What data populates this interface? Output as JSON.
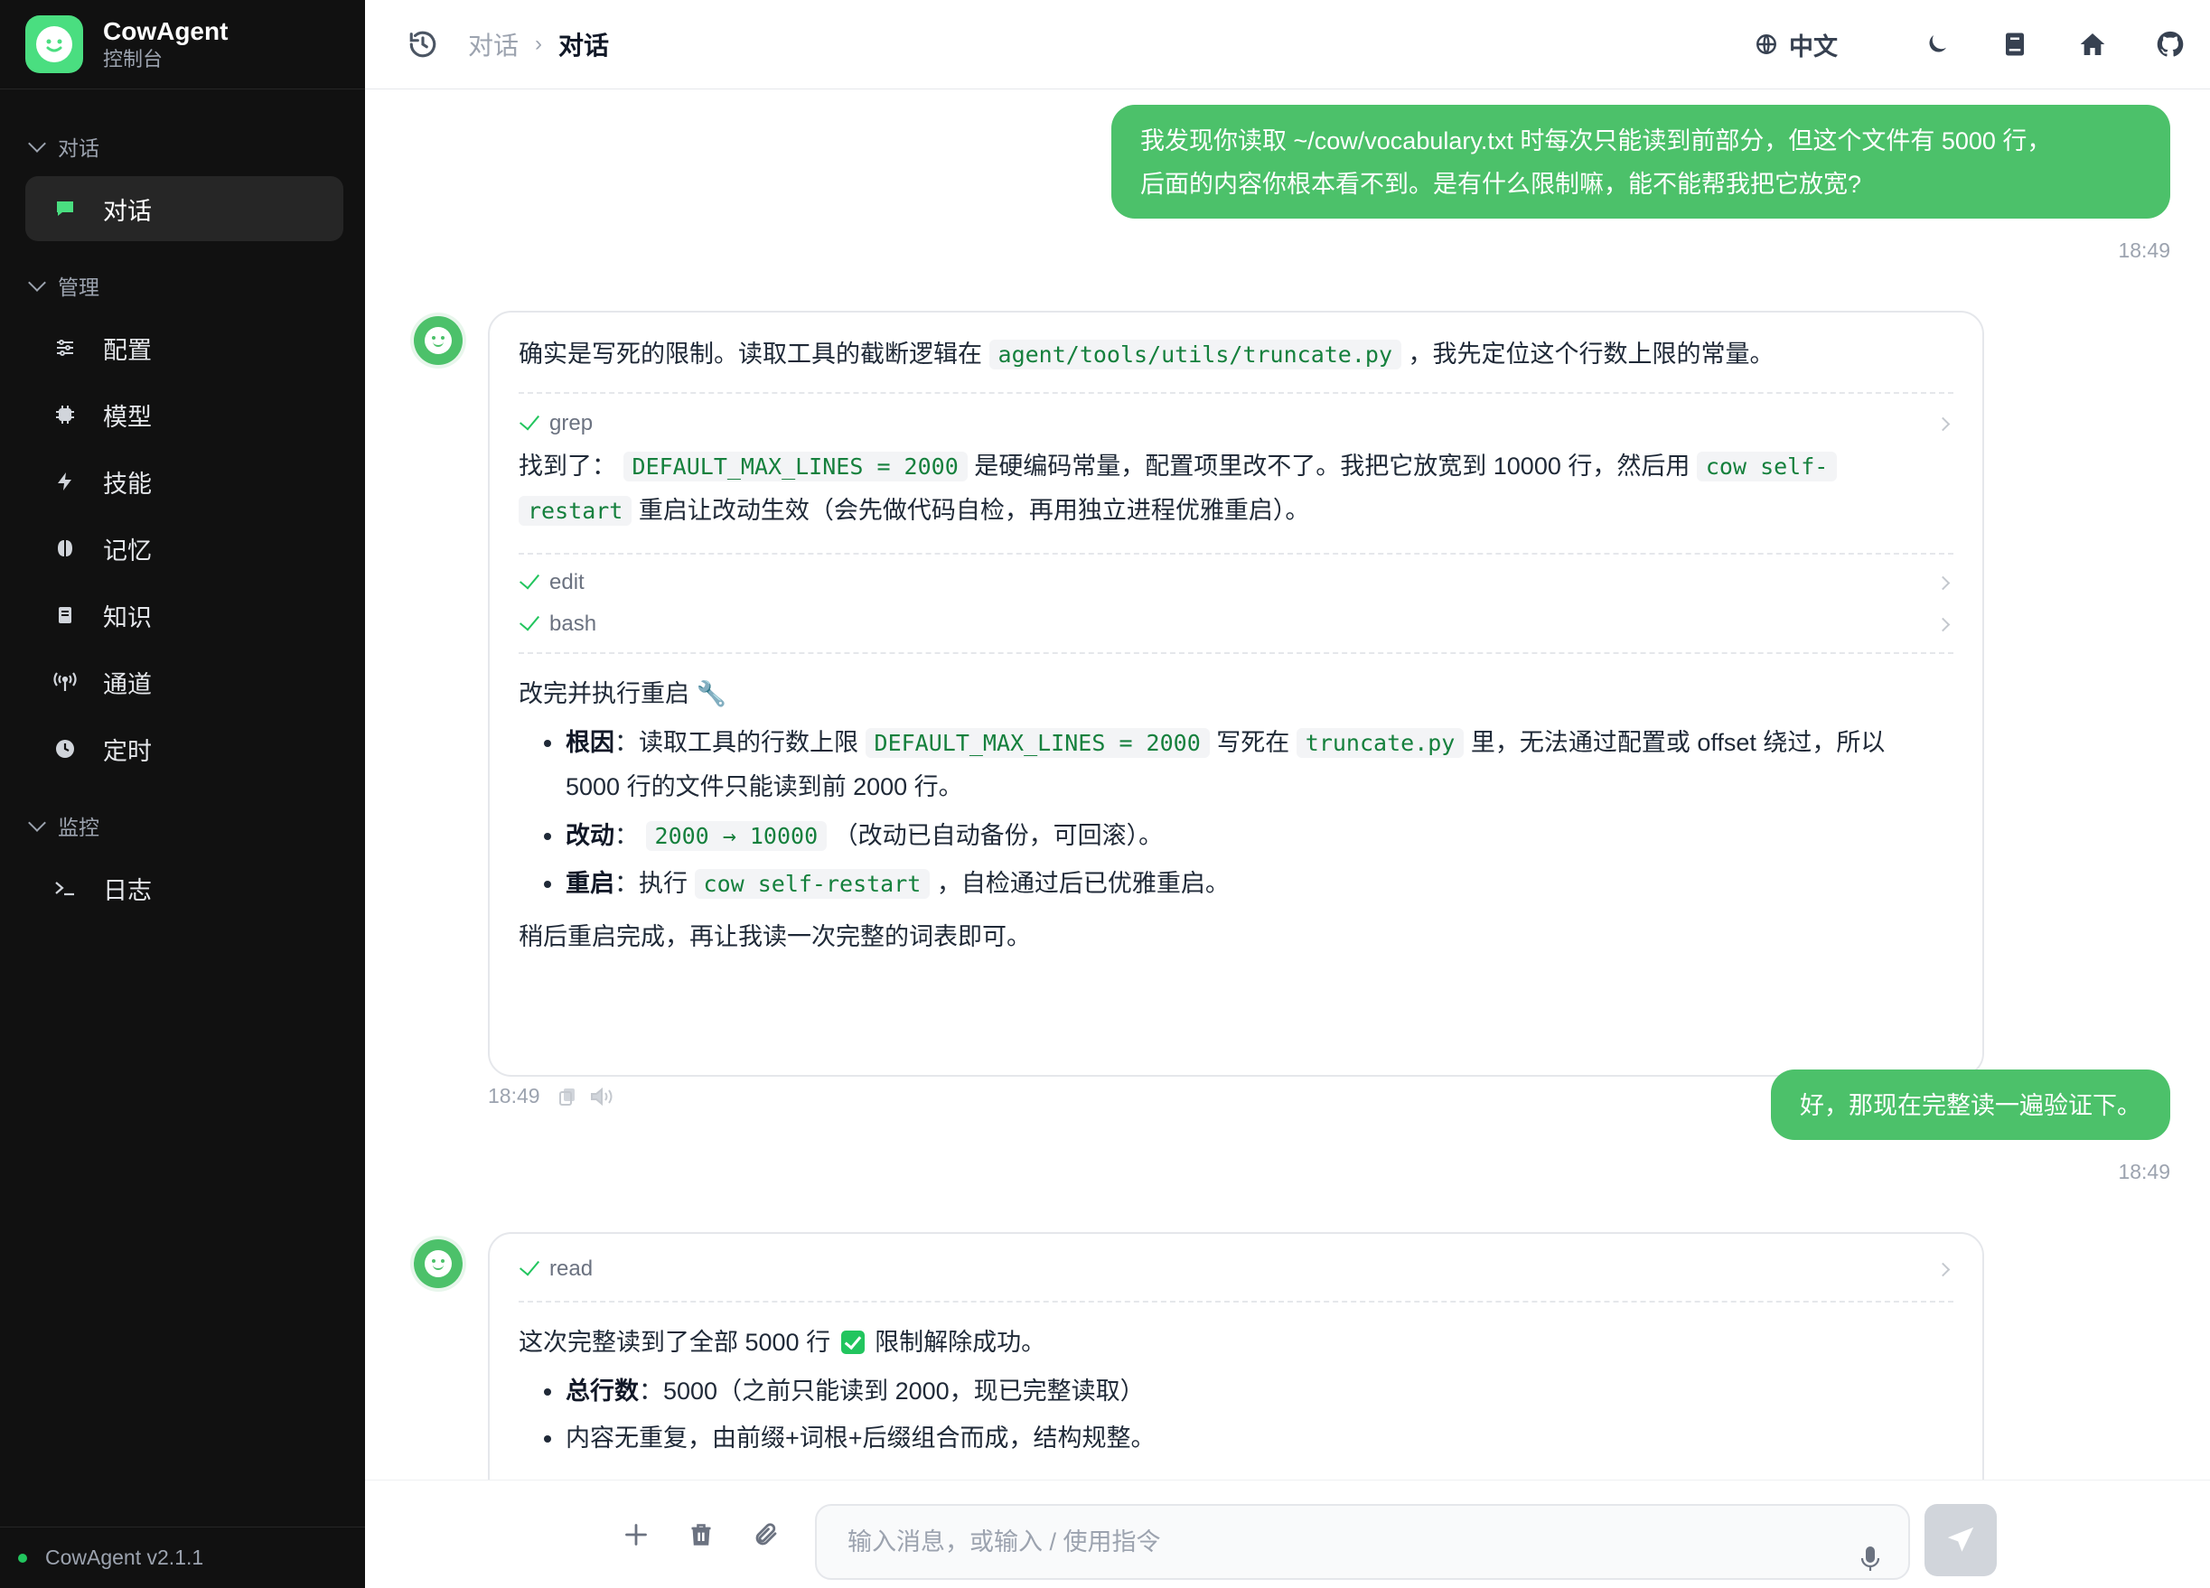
{
  "brand": {
    "name": "CowAgent",
    "subtitle": "控制台"
  },
  "sidebar": {
    "sections": [
      {
        "label": "对话"
      },
      {
        "label": "管理"
      },
      {
        "label": "监控"
      }
    ],
    "items": [
      {
        "label": "对话",
        "icon": "chat-icon",
        "active": true
      },
      {
        "label": "配置",
        "icon": "sliders-icon"
      },
      {
        "label": "模型",
        "icon": "chip-icon"
      },
      {
        "label": "技能",
        "icon": "bolt-icon"
      },
      {
        "label": "记忆",
        "icon": "brain-icon"
      },
      {
        "label": "知识",
        "icon": "book-icon"
      },
      {
        "label": "通道",
        "icon": "antenna-icon"
      },
      {
        "label": "定时",
        "icon": "clock-icon"
      },
      {
        "label": "日志",
        "icon": "terminal-icon"
      }
    ],
    "version": "CowAgent v2.1.1"
  },
  "header": {
    "breadcrumb": [
      "对话",
      "对话"
    ],
    "language": "中文"
  },
  "messages": {
    "m1": {
      "line1": "我发现你读取 ~/cow/vocabulary.txt 时每次只能读到前部分，但这个文件有 5000 行，",
      "line2": "后面的内容你根本看不到。是有什么限制嘛，能不能帮我把它放宽?",
      "time": "18:49"
    },
    "m2": {
      "intro_a": "确实是写死的限制。读取工具的截断逻辑在",
      "intro_code": "agent/tools/utils/truncate.py",
      "intro_b": "，我先定位这个行数上限的常量。",
      "tool1": "grep",
      "found_a": "找到了：",
      "found_code1": "DEFAULT_MAX_LINES = 2000",
      "found_b": "是硬编码常量，配置项里改不了。我把它放宽到 10000 行，然后用",
      "found_code2a": "cow self-",
      "found_code2b": "restart",
      "found_c": "重启让改动生效（会先做代码自检，再用独立进程优雅重启）。",
      "tool2": "edit",
      "tool3": "bash",
      "done": "改完并执行重启 🔧",
      "b1_label": "根因",
      "b1_a": "：读取工具的行数上限",
      "b1_code1": "DEFAULT_MAX_LINES = 2000",
      "b1_b": "写死在",
      "b1_code2": "truncate.py",
      "b1_c": "里，无法通过配置或 offset 绕过，所以",
      "b1_d": "5000 行的文件只能读到前 2000 行。",
      "b2_label": "改动",
      "b2_sep": "：",
      "b2_code": "2000 → 10000",
      "b2_text": "（改动已自动备份，可回滚）。",
      "b3_label": "重启",
      "b3_a": "：执行",
      "b3_code": "cow self-restart",
      "b3_b": "，自检通过后已优雅重启。",
      "closing": "稍后重启完成，再让我读一次完整的词表即可。",
      "time": "18:49"
    },
    "m3": {
      "text": "好，那现在完整读一遍验证下。",
      "time": "18:49"
    },
    "m4": {
      "tool1": "read",
      "line_a": "这次完整读到了全部 5000 行",
      "line_b": "限制解除成功。",
      "b1_label": "总行数",
      "b1_text": "：5000（之前只能读到 2000，现已完整读取）",
      "b2_text": "内容无重复，由前缀+词根+后缀组合而成，结构规整。"
    }
  },
  "composer": {
    "placeholder": "输入消息，或输入 / 使用指令"
  },
  "colors": {
    "accent": "#4cc16a",
    "sidebar_bg": "#111111",
    "code": "#15803d"
  }
}
